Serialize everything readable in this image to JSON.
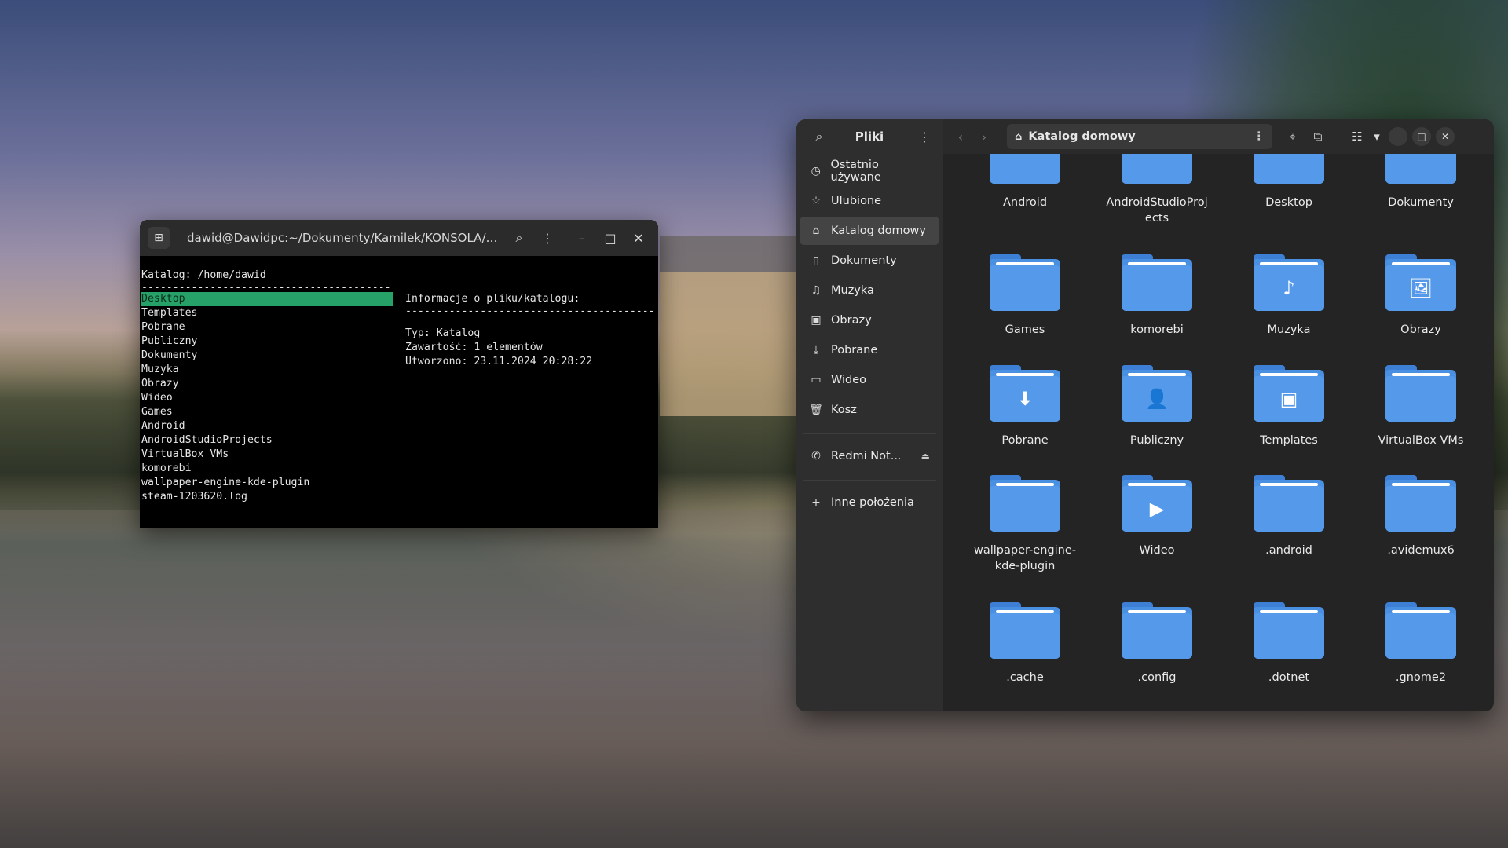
{
  "terminal": {
    "title": "dawid@Dawidpc:~/Dokumenty/Kamilek/KONSOLA/Moja...",
    "header_line": "Katalog: /home/dawid",
    "divider_left": "----------------------------------------",
    "info_title": "Informacje o pliku/katalogu:",
    "divider_right": "----------------------------------------",
    "info_type": "Typ: Katalog",
    "info_contents": "Zawartość: 1 elementów",
    "info_created": "Utworzono: 23.11.2024 20:28:22",
    "entries": [
      "Desktop",
      "Templates",
      "Pobrane",
      "Publiczny",
      "Dokumenty",
      "Muzyka",
      "Obrazy",
      "Wideo",
      "Games",
      "Android",
      "AndroidStudioProjects",
      "VirtualBox VMs",
      "komorebi",
      "wallpaper-engine-kde-plugin",
      "steam-1203620.log"
    ],
    "selected_index": 0
  },
  "files": {
    "app_title": "Pliki",
    "path": "Katalog domowy",
    "sidebar": [
      {
        "label": "Ostatnio używane",
        "icon": "clock-icon"
      },
      {
        "label": "Ulubione",
        "icon": "star-icon"
      },
      {
        "label": "Katalog domowy",
        "icon": "home-icon",
        "active": true
      },
      {
        "label": "Dokumenty",
        "icon": "document-icon"
      },
      {
        "label": "Muzyka",
        "icon": "music-icon"
      },
      {
        "label": "Obrazy",
        "icon": "image-icon"
      },
      {
        "label": "Pobrane",
        "icon": "download-icon"
      },
      {
        "label": "Wideo",
        "icon": "video-icon"
      },
      {
        "label": "Kosz",
        "icon": "trash-icon"
      }
    ],
    "device": "Redmi Not...",
    "other_locations": "Inne położenia",
    "folders": [
      {
        "name": "Android",
        "emblem": ""
      },
      {
        "name": "AndroidStudioProjects",
        "emblem": ""
      },
      {
        "name": "Desktop",
        "emblem": "desktop"
      },
      {
        "name": "Dokumenty",
        "emblem": "doc"
      },
      {
        "name": "Games",
        "emblem": ""
      },
      {
        "name": "komorebi",
        "emblem": ""
      },
      {
        "name": "Muzyka",
        "emblem": "♪"
      },
      {
        "name": "Obrazy",
        "emblem": "🖼"
      },
      {
        "name": "Pobrane",
        "emblem": "⬇"
      },
      {
        "name": "Publiczny",
        "emblem": "👤"
      },
      {
        "name": "Templates",
        "emblem": "▣"
      },
      {
        "name": "VirtualBox VMs",
        "emblem": ""
      },
      {
        "name": "wallpaper-engine-kde-plugin",
        "emblem": ""
      },
      {
        "name": "Wideo",
        "emblem": "▶"
      },
      {
        "name": ".android",
        "emblem": ""
      },
      {
        "name": ".avidemux6",
        "emblem": ""
      },
      {
        "name": ".cache",
        "emblem": ""
      },
      {
        "name": ".config",
        "emblem": ""
      },
      {
        "name": ".dotnet",
        "emblem": ""
      },
      {
        "name": ".gnome2",
        "emblem": ""
      }
    ],
    "labels_override": {
      "1": "AndroidStudioProj\nects",
      "12": "wallpaper-engine-\nkde-plugin"
    }
  },
  "colors": {
    "selection": "#26a269",
    "folder": "#4a90e2"
  }
}
